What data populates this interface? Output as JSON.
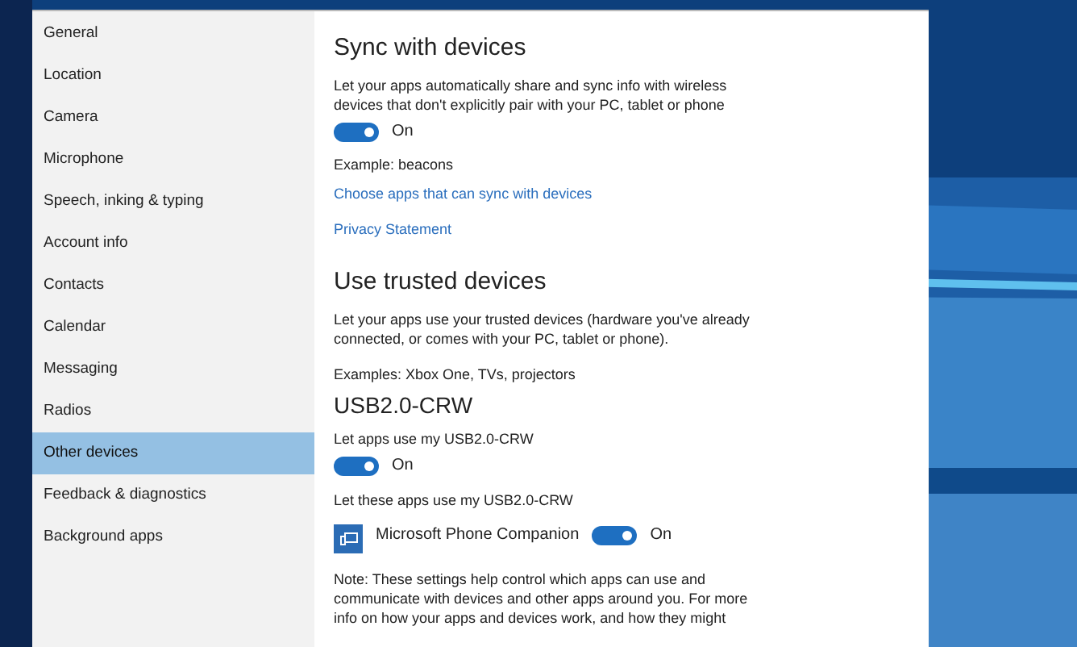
{
  "sidebar": {
    "items": [
      {
        "label": "General",
        "selected": false
      },
      {
        "label": "Location",
        "selected": false
      },
      {
        "label": "Camera",
        "selected": false
      },
      {
        "label": "Microphone",
        "selected": false
      },
      {
        "label": "Speech, inking & typing",
        "selected": false
      },
      {
        "label": "Account info",
        "selected": false
      },
      {
        "label": "Contacts",
        "selected": false
      },
      {
        "label": "Calendar",
        "selected": false
      },
      {
        "label": "Messaging",
        "selected": false
      },
      {
        "label": "Radios",
        "selected": false
      },
      {
        "label": "Other devices",
        "selected": true
      },
      {
        "label": "Feedback & diagnostics",
        "selected": false
      },
      {
        "label": "Background apps",
        "selected": false
      }
    ]
  },
  "sync": {
    "title": "Sync with devices",
    "description": "Let your apps automatically share and sync info with wireless devices that don't explicitly pair with your PC, tablet or phone",
    "toggle": {
      "on": true,
      "label": "On"
    },
    "example": "Example: beacons",
    "links": [
      "Choose apps that can sync with devices",
      "Privacy Statement"
    ]
  },
  "trusted": {
    "title": "Use trusted devices",
    "description": "Let your apps use your trusted devices (hardware you've already connected, or comes with your PC, tablet or phone).",
    "examples": "Examples: Xbox One, TVs, projectors",
    "device": {
      "title": "USB2.0-CRW",
      "allow_label": "Let apps use my USB2.0-CRW",
      "toggle": {
        "on": true,
        "label": "On"
      },
      "apps_label": "Let these apps use my USB2.0-CRW",
      "apps": [
        {
          "name": "Microsoft Phone Companion",
          "toggle": {
            "on": true,
            "label": "On"
          }
        }
      ]
    },
    "note": "Note: These settings help control which apps can use and communicate with devices and other apps around you. For more info on how your apps and devices work, and how they might"
  }
}
